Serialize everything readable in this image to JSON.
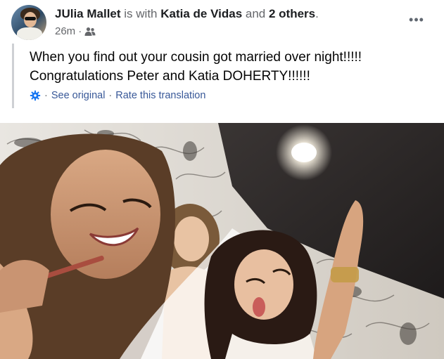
{
  "post": {
    "author": "JUlia Mallet",
    "with_word": "is with",
    "tagged": "Katia de Vidas",
    "and_word": "and",
    "others": "2 others",
    "end_period": ".",
    "time": "26m",
    "separator": "·",
    "audience_icon": "friends-icon",
    "more_icon": "•••",
    "text_lines": [
      "When you find out your cousin got married over night!!!!!",
      "Congratulations Peter and Katia DOHERTY!!!!!!"
    ],
    "translation": {
      "icon": "gear-icon",
      "see_original": "See original",
      "separator": "·",
      "rate": "Rate this translation"
    }
  },
  "photo": {
    "description_icon": "wedding-selfie-photo"
  },
  "colors": {
    "link": "#385898",
    "muted": "#65676b",
    "bar": "#ced0d4",
    "gear": "#1877f2"
  }
}
